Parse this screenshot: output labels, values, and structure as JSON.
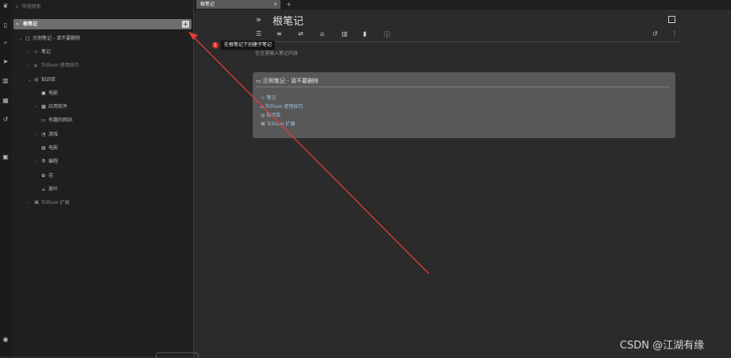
{
  "launcher": {
    "icons": [
      "trillium-logo-icon",
      "new-note-icon",
      "search-icon",
      "send-icon",
      "map-icon",
      "calendar-icon",
      "history-icon",
      "today-icon",
      "global-menu-icon"
    ]
  },
  "tree": {
    "search_placeholder": "快速搜索",
    "root": {
      "label": "根笔记",
      "add_glyph": "+"
    },
    "items": [
      {
        "label": "示例笔记 - 请不要删除",
        "caret": "⌄",
        "icon": "□"
      },
      {
        "label": "笔记",
        "caret": "›",
        "icon": "☆"
      },
      {
        "label": "Trillium 使用技巧",
        "caret": "›",
        "icon": "⌂"
      },
      {
        "label": "知识库",
        "caret": "⌄",
        "icon": "◎"
      },
      {
        "label": "电影",
        "caret": "",
        "icon": "▣"
      },
      {
        "label": "应用软件",
        "caret": "›",
        "icon": "▦"
      },
      {
        "label": "有趣的网站",
        "caret": "",
        "icon": "▭"
      },
      {
        "label": "游戏",
        "caret": "›",
        "icon": "◔"
      },
      {
        "label": "电影",
        "caret": "",
        "icon": "▤"
      },
      {
        "label": "编程",
        "caret": "›",
        "icon": "⚗"
      },
      {
        "label": "花",
        "caret": "",
        "icon": "✿"
      },
      {
        "label": "茶叶",
        "caret": "",
        "icon": "☕"
      },
      {
        "label": "Trillium 扩展",
        "caret": "›",
        "icon": "⌘"
      }
    ]
  },
  "tabs": [
    {
      "label": "根笔记",
      "close": "×"
    }
  ],
  "tab_new": "+",
  "note": {
    "chevron": "»",
    "title": "根笔记",
    "placeholder": "在这里输入笔记内容",
    "toolbar_icons": [
      "format-icon",
      "list-icon",
      "sort-icon",
      "lock-icon",
      "map-icon",
      "stats-icon",
      "info-icon"
    ],
    "right_icons": [
      "history-icon",
      "more-menu-icon"
    ]
  },
  "tooltip": {
    "badge": "1",
    "text": "在根笔记下创建子笔记"
  },
  "card": {
    "title": "示例笔记 - 请不要删除",
    "items": [
      {
        "icon": "☆",
        "label": "笔记"
      },
      {
        "icon": "⌂",
        "label": "Trillium 使用技巧"
      },
      {
        "icon": "◎",
        "label": "知识库"
      },
      {
        "icon": "⌘",
        "label": "Trillium 扩展"
      }
    ]
  },
  "watermark": "CSDN @江湖有缘",
  "colors": {
    "arrow": "#e23a3a",
    "badge": "#e3332b",
    "link": "#9cc3e6"
  }
}
